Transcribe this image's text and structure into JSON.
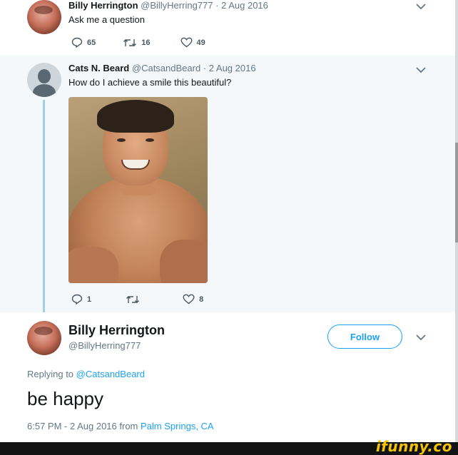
{
  "tweet1": {
    "name": "Billy Herrington",
    "handle": "@BillyHerring777",
    "separator": "·",
    "date": "2 Aug 2016",
    "text": "Ask me a question",
    "replies": "65",
    "retweets": "16",
    "likes": "49"
  },
  "tweet2": {
    "name": "Cats N. Beard",
    "handle": "@CatsandBeard",
    "separator": "·",
    "date": "2 Aug 2016",
    "text": "How do I achieve a smile this beautiful?",
    "replies": "1",
    "retweets": "",
    "likes": "8"
  },
  "tweet3": {
    "name": "Billy Herrington",
    "handle": "@BillyHerring777",
    "follow_label": "Follow",
    "replying_prefix": "Replying to",
    "replying_to": "@CatsandBeard",
    "text": "be happy",
    "time": "6:57 PM - 2 Aug 2016",
    "from_prefix": "from",
    "location": "Palm Springs, CA"
  },
  "watermark": "ifunny.co",
  "icons": {
    "reply": "reply-icon",
    "retweet": "retweet-icon",
    "like": "heart-icon",
    "more": "chevron-down-icon"
  },
  "colors": {
    "accent": "#1da1f2",
    "muted": "#657786",
    "thread_line": "#9fd0e6",
    "highlight_bg": "#f5f8fa"
  }
}
